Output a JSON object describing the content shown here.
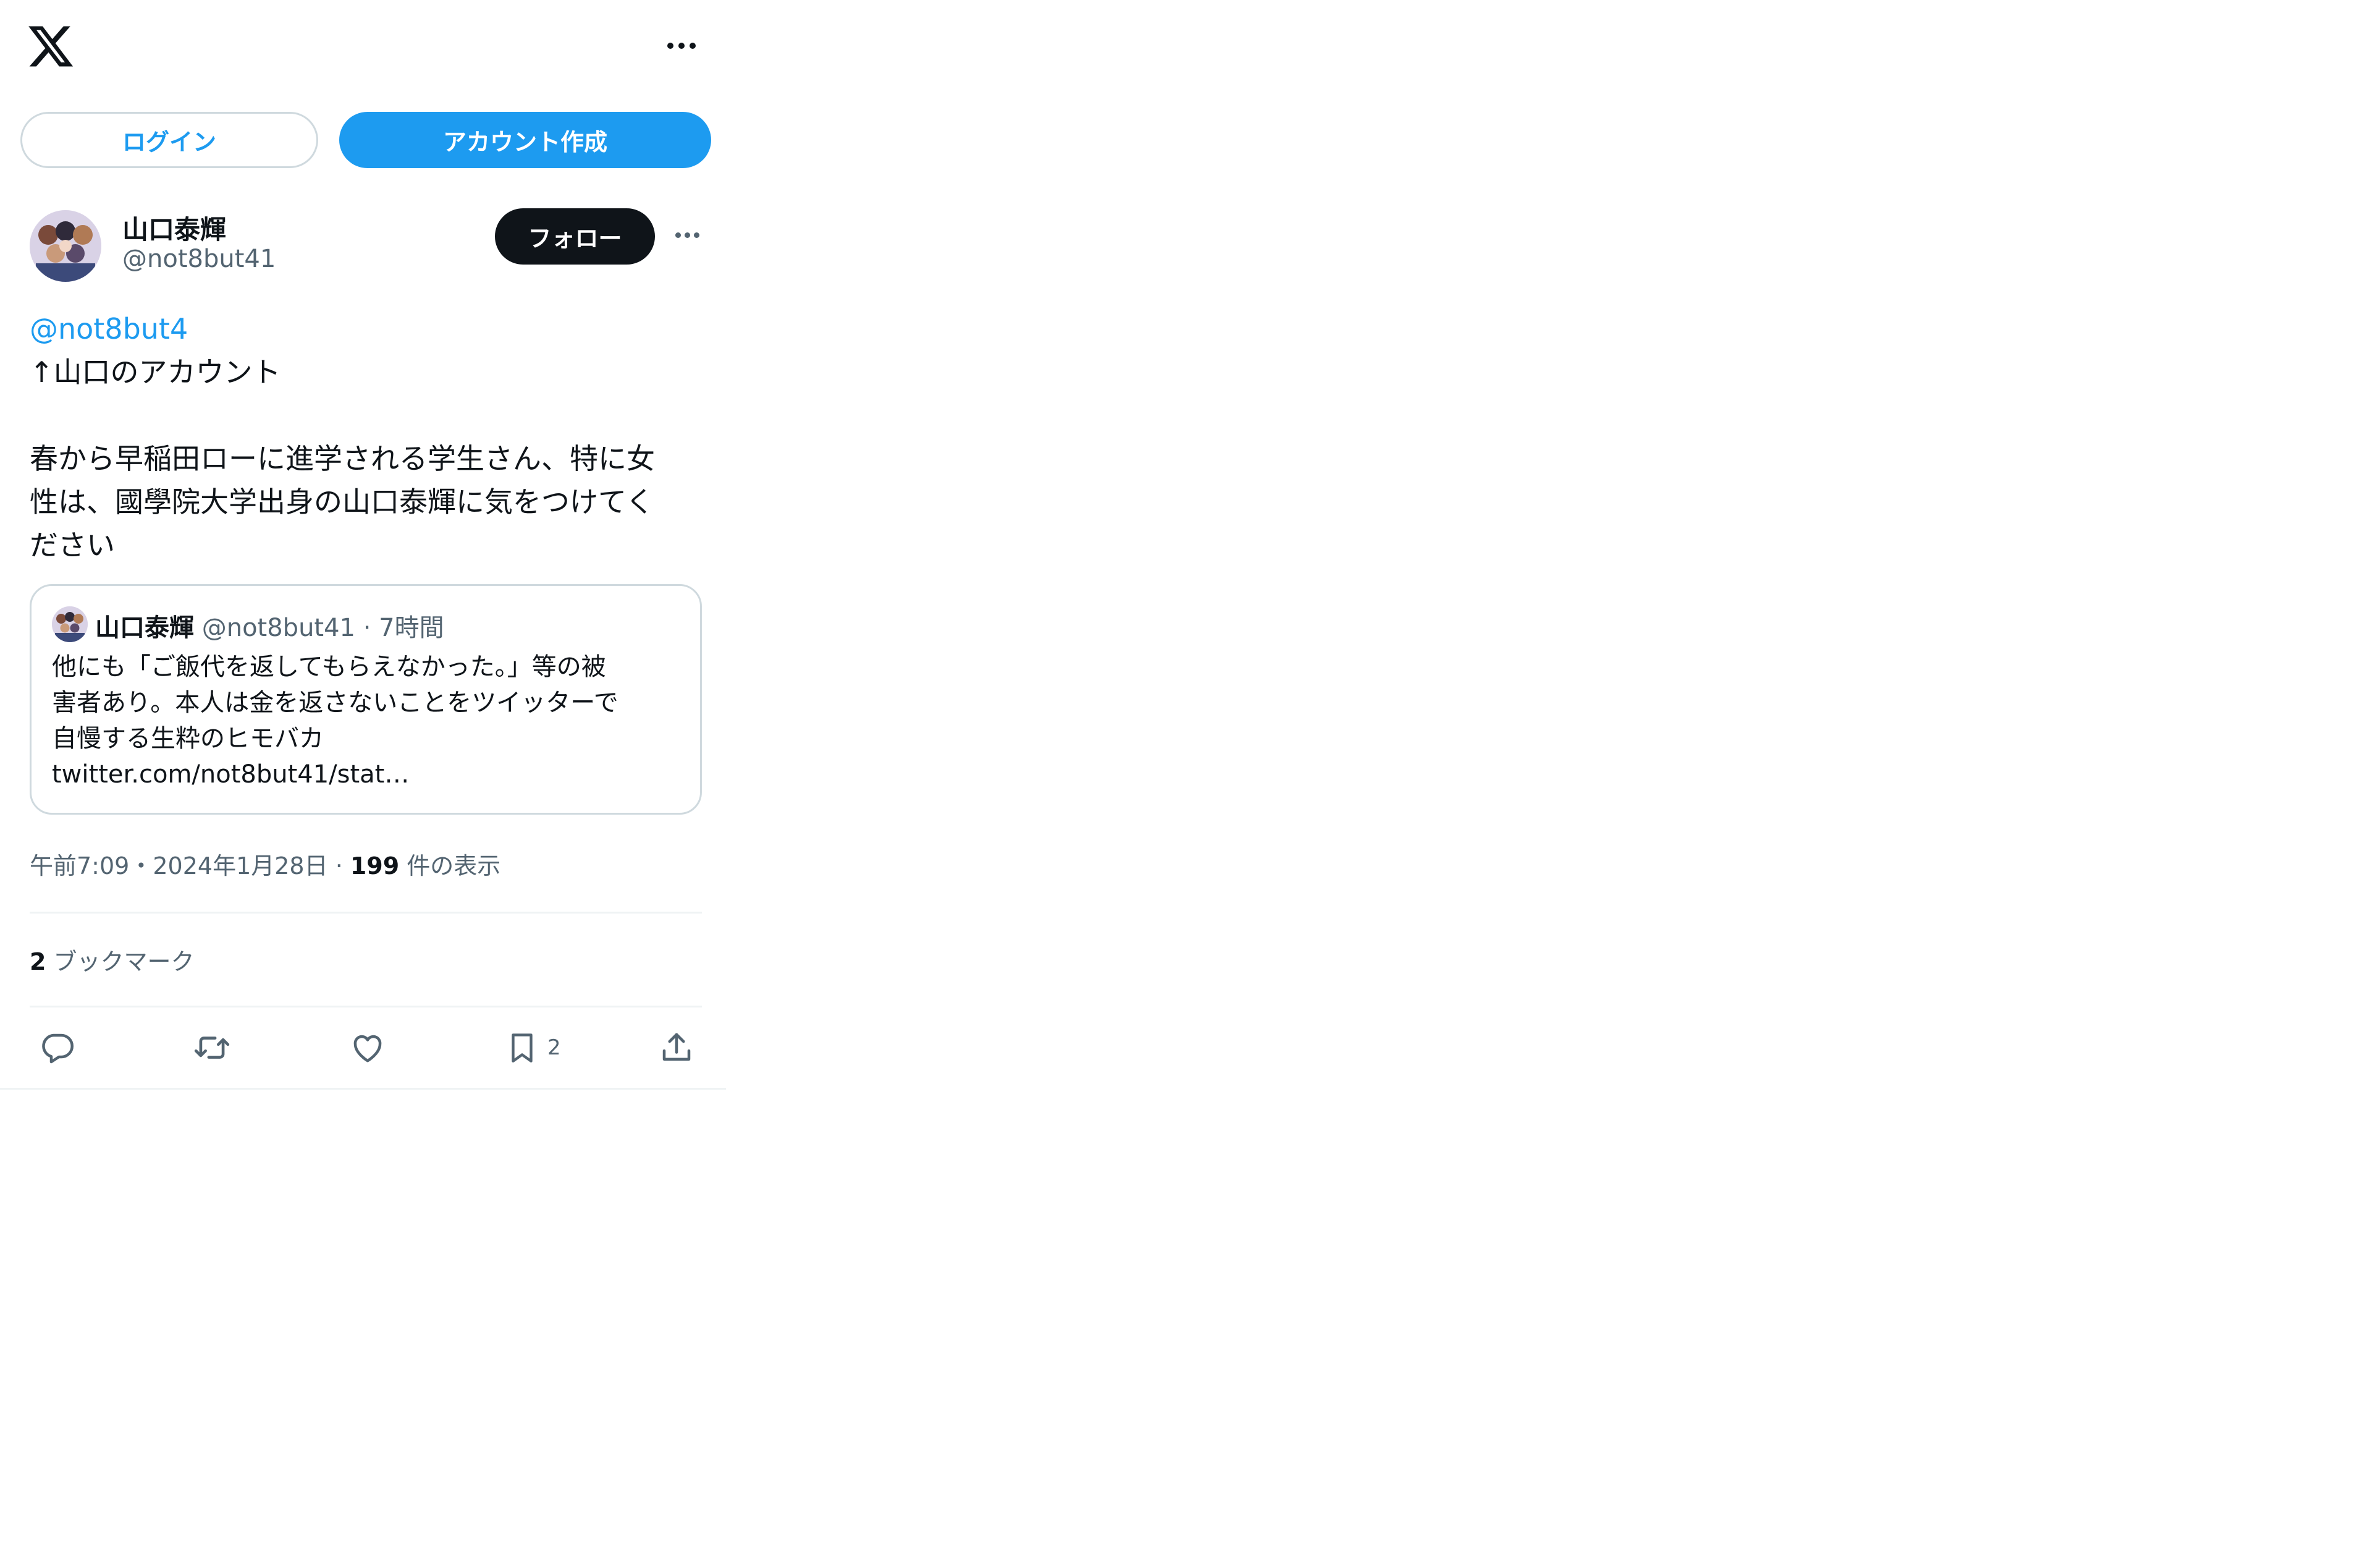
{
  "header": {
    "logo_icon": "x-logo-icon",
    "more_icon": "more-horizontal-icon"
  },
  "auth": {
    "login_label": "ログイン",
    "signup_label": "アカウント作成"
  },
  "tweet": {
    "author": {
      "name": "山口泰輝",
      "handle": "@not8but41"
    },
    "follow_label": "フォロー",
    "text": {
      "mention": "@not8but4",
      "line1": "↑山口のアカウント",
      "line2": "春から早稲田ローに進学される学生さん、特に女",
      "line3": "性は、國學院大学出身の山口泰輝に気をつけてく",
      "line4": "ださい"
    },
    "quote": {
      "name": "山口泰輝",
      "handle": "@not8but41",
      "separator": "·",
      "time": "7時間",
      "line1": "他にも「ご飯代を返してもらえなかった。」等の被",
      "line2": "害者あり。本人は金を返さないことをツイッターで",
      "line3": "自慢する生粋のヒモバカ",
      "line4": "twitter.com/not8but41/stat…"
    },
    "meta": {
      "time": "午前7:09",
      "sep1": "・",
      "date": "2024年1月28日",
      "sep2": " · ",
      "views_count": "199",
      "views_label": " 件の表示"
    },
    "bookmarks": {
      "count": "2",
      "label": " ブックマーク"
    },
    "actions": {
      "reply_icon": "reply-icon",
      "retweet_icon": "retweet-icon",
      "like_icon": "heart-icon",
      "bookmark_icon": "bookmark-icon",
      "bookmark_count": "2",
      "share_icon": "share-icon"
    }
  },
  "colors": {
    "accent": "#1d9bf0",
    "text": "#0f1419",
    "muted": "#536471",
    "border": "#cfd9de"
  }
}
